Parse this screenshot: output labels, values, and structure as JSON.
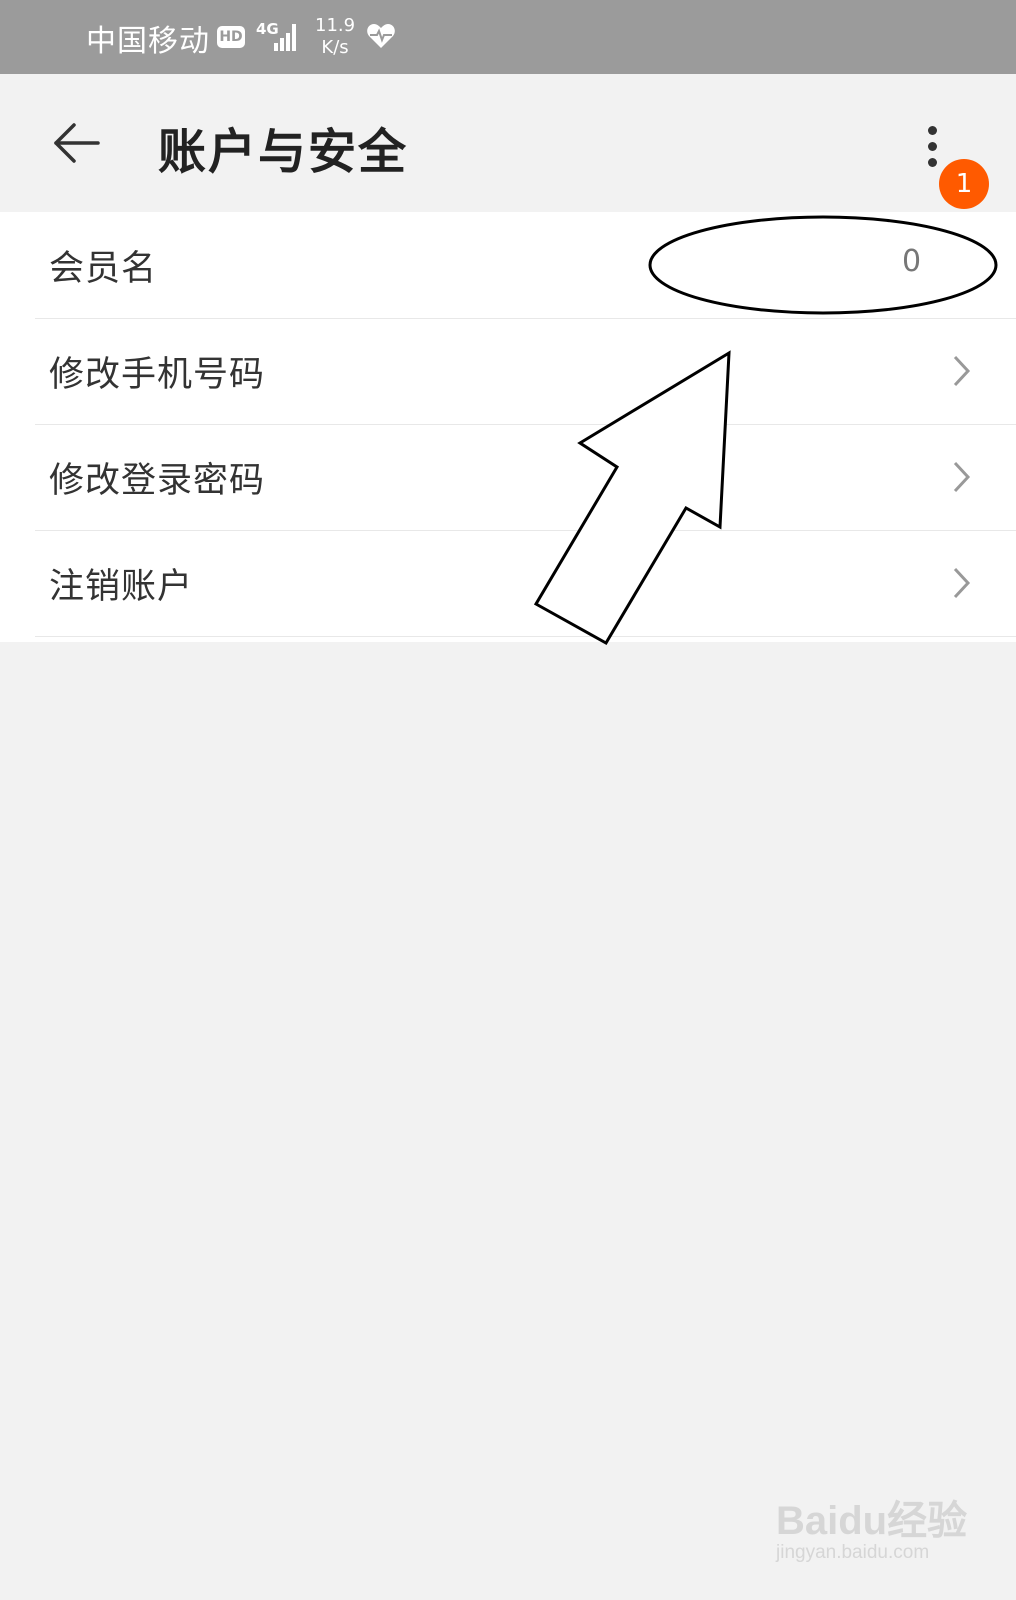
{
  "status_bar": {
    "carrier": "中国移动",
    "hd_badge": "HD",
    "network": "4G",
    "speed_value": "11.9",
    "speed_unit": "K/s",
    "icons": [
      "hd-icon",
      "signal-icon",
      "heart-icon"
    ]
  },
  "app_bar": {
    "title": "账户与安全",
    "back_icon": "back-arrow-icon",
    "menu_icon": "more-vertical-icon",
    "notification_count": "1"
  },
  "settings_list": [
    {
      "label": "会员名",
      "value": "0",
      "has_chevron": false
    },
    {
      "label": "修改手机号码",
      "value": "",
      "has_chevron": true
    },
    {
      "label": "修改登录密码",
      "value": "",
      "has_chevron": true
    },
    {
      "label": "注销账户",
      "value": "",
      "has_chevron": true
    }
  ],
  "watermark": {
    "brand": "Baidu经验",
    "url": "jingyan.baidu.com"
  },
  "colors": {
    "status_bar": "#9b9b9b",
    "page_background": "#f2f2f2",
    "badge": "#ff5a00"
  }
}
